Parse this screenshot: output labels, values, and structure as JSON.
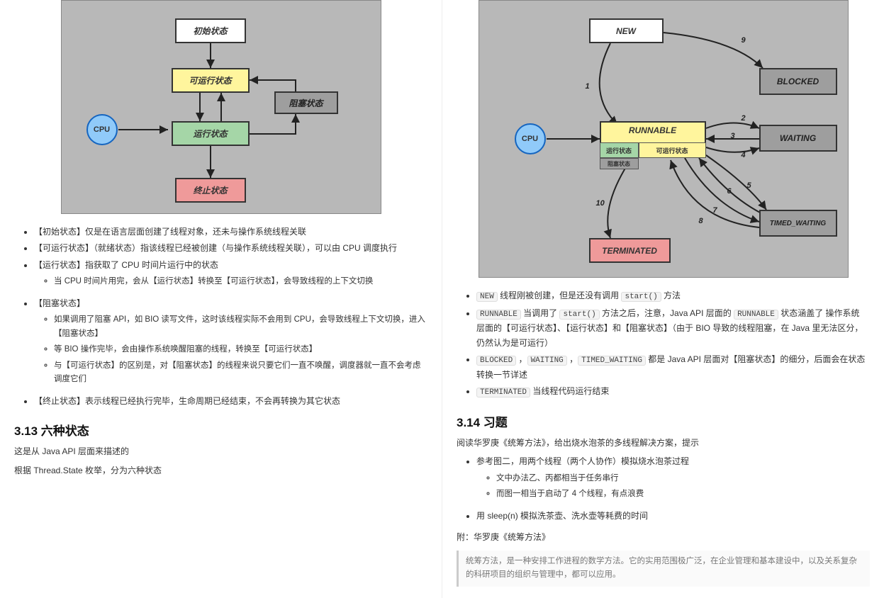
{
  "diagram1": {
    "cpu": "CPU",
    "initial": "初始状态",
    "runnable": "可运行状态",
    "running": "运行状态",
    "blocked": "阻塞状态",
    "terminated": "终止状态"
  },
  "bullets_left": {
    "b1": "【初始状态】仅是在语言层面创建了线程对象，还未与操作系统线程关联",
    "b2": "【可运行状态】（就绪状态）指该线程已经被创建（与操作系统线程关联），可以由 CPU 调度执行",
    "b3": "【运行状态】指获取了 CPU 时间片运行中的状态",
    "b3a": "当 CPU 时间片用完，会从【运行状态】转换至【可运行状态】，会导致线程的上下文切换",
    "b4": "【阻塞状态】",
    "b4a": "如果调用了阻塞 API，如 BIO 读写文件，这时该线程实际不会用到 CPU，会导致线程上下文切换，进入【阻塞状态】",
    "b4b": "等 BIO 操作完毕，会由操作系统唤醒阻塞的线程，转换至【可运行状态】",
    "b4c": "与【可运行状态】的区别是，对【阻塞状态】的线程来说只要它们一直不唤醒，调度器就一直不会考虑调度它们",
    "b5": "【终止状态】表示线程已经执行完毕，生命周期已经结束，不会再转换为其它状态"
  },
  "section313": {
    "title": "3.13 六种状态",
    "p1": "这是从 Java API 层面来描述的",
    "p2": "根据 Thread.State 枚举，分为六种状态"
  },
  "diagram2": {
    "cpu": "CPU",
    "new": "NEW",
    "runnable": "RUNNABLE",
    "sub_run": "运行状态",
    "sub_ready": "可运行状态",
    "sub_block": "阻塞状态",
    "blocked": "BLOCKED",
    "waiting": "WAITING",
    "timed": "TIMED_WAITING",
    "terminated": "TERMINATED",
    "edge_labels": {
      "e1": "1",
      "e2": "2",
      "e3": "3",
      "e4": "4",
      "e5": "5",
      "e6": "6",
      "e7": "7",
      "e8": "8",
      "e9": "9",
      "e10": "10"
    }
  },
  "bullets_right": {
    "b1_pre": " 线程刚被创建，但是还没有调用 ",
    "b1_post": " 方法",
    "b1_code1": "NEW",
    "b1_code2": "start()",
    "b2_pre": " 当调用了 ",
    "b2_mid": " 方法之后，注意，Java API 层面的 ",
    "b2_post": " 状态涵盖了 操作系统 层面的【可运行状态】、【运行状态】和【阻塞状态】（由于 BIO 导致的线程阻塞，在 Java 里无法区分，仍然认为是可运行）",
    "b2_code1": "RUNNABLE",
    "b2_code2": "start()",
    "b2_code3": "RUNNABLE",
    "b3_pre": " ，",
    "b3_mid1": " ，",
    "b3_mid2": " 都是 Java API 层面对【阻塞状态】的细分，后面会在状态转换一节详述",
    "b3_code1": "BLOCKED",
    "b3_code2": "WAITING",
    "b3_code3": "TIMED_WAITING",
    "b4_pre": " 当线程代码运行结束",
    "b4_code1": "TERMINATED"
  },
  "section314": {
    "title": "3.14 习题",
    "p1": "阅读华罗庚《统筹方法》，给出烧水泡茶的多线程解决方案，提示",
    "b1": "参考图二，用两个线程（两个人协作）模拟烧水泡茶过程",
    "b1a": "文中办法乙、丙都相当于任务串行",
    "b1b": "而图一相当于启动了 4 个线程，有点浪费",
    "b2": "用 sleep(n) 模拟洗茶壶、洗水壶等耗费的时间",
    "p2": "附：华罗庚《统筹方法》",
    "quote": "统筹方法，是一种安排工作进程的数学方法。它的实用范围极广泛，在企业管理和基本建设中，以及关系复杂的科研项目的组织与管理中，都可以应用。"
  }
}
